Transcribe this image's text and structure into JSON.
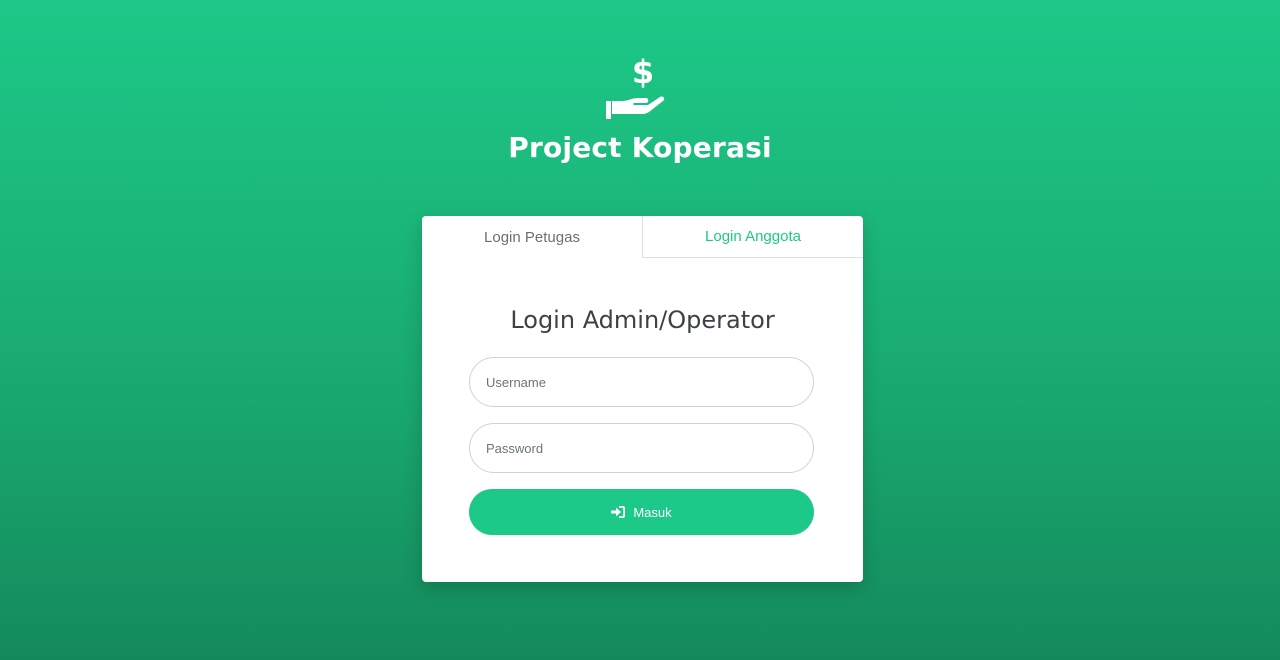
{
  "brand": {
    "title": "Project Koperasi",
    "logo_icon": "hand-holding-dollar-icon"
  },
  "tabs": [
    {
      "label": "Login Petugas",
      "active": true
    },
    {
      "label": "Login Anggota",
      "active": false
    }
  ],
  "form": {
    "title": "Login Admin/Operator",
    "username_placeholder": "Username",
    "password_placeholder": "Password",
    "submit_label": "Masuk",
    "submit_icon": "sign-in-icon"
  },
  "colors": {
    "primary": "#1dc988",
    "background_top": "#1dc988",
    "background_bottom": "#148a5c",
    "card": "#ffffff"
  }
}
